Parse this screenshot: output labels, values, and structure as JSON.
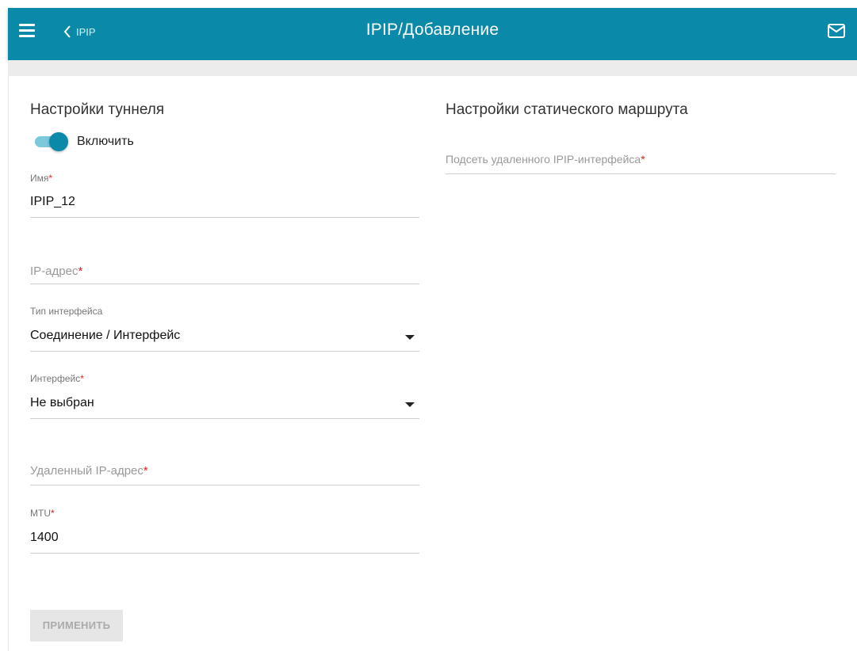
{
  "header": {
    "back_label": "IPIP",
    "title": "IPIP/Добавление",
    "brand_color": "#0a89a8"
  },
  "tunnel_settings": {
    "title": "Настройки туннеля",
    "enable_label": "Включить",
    "enabled": true,
    "name": {
      "label": "Имя",
      "value": "IPIP_12"
    },
    "ip_address": {
      "placeholder": "IP-адрес"
    },
    "interface_type": {
      "label": "Тип интерфейса",
      "value": "Соединение / Интерфейс"
    },
    "interface": {
      "label": "Интерфейс",
      "value": "Не выбран"
    },
    "remote_ip": {
      "placeholder": "Удаленный IP-адрес"
    },
    "mtu": {
      "label": "MTU",
      "value": "1400"
    }
  },
  "static_route": {
    "title": "Настройки статического маршрута",
    "remote_subnet": {
      "placeholder": "Подсеть удаленного IPIP-интерфейса"
    }
  },
  "required_mark": "*",
  "apply_label": "ПРИМЕНИТЬ"
}
